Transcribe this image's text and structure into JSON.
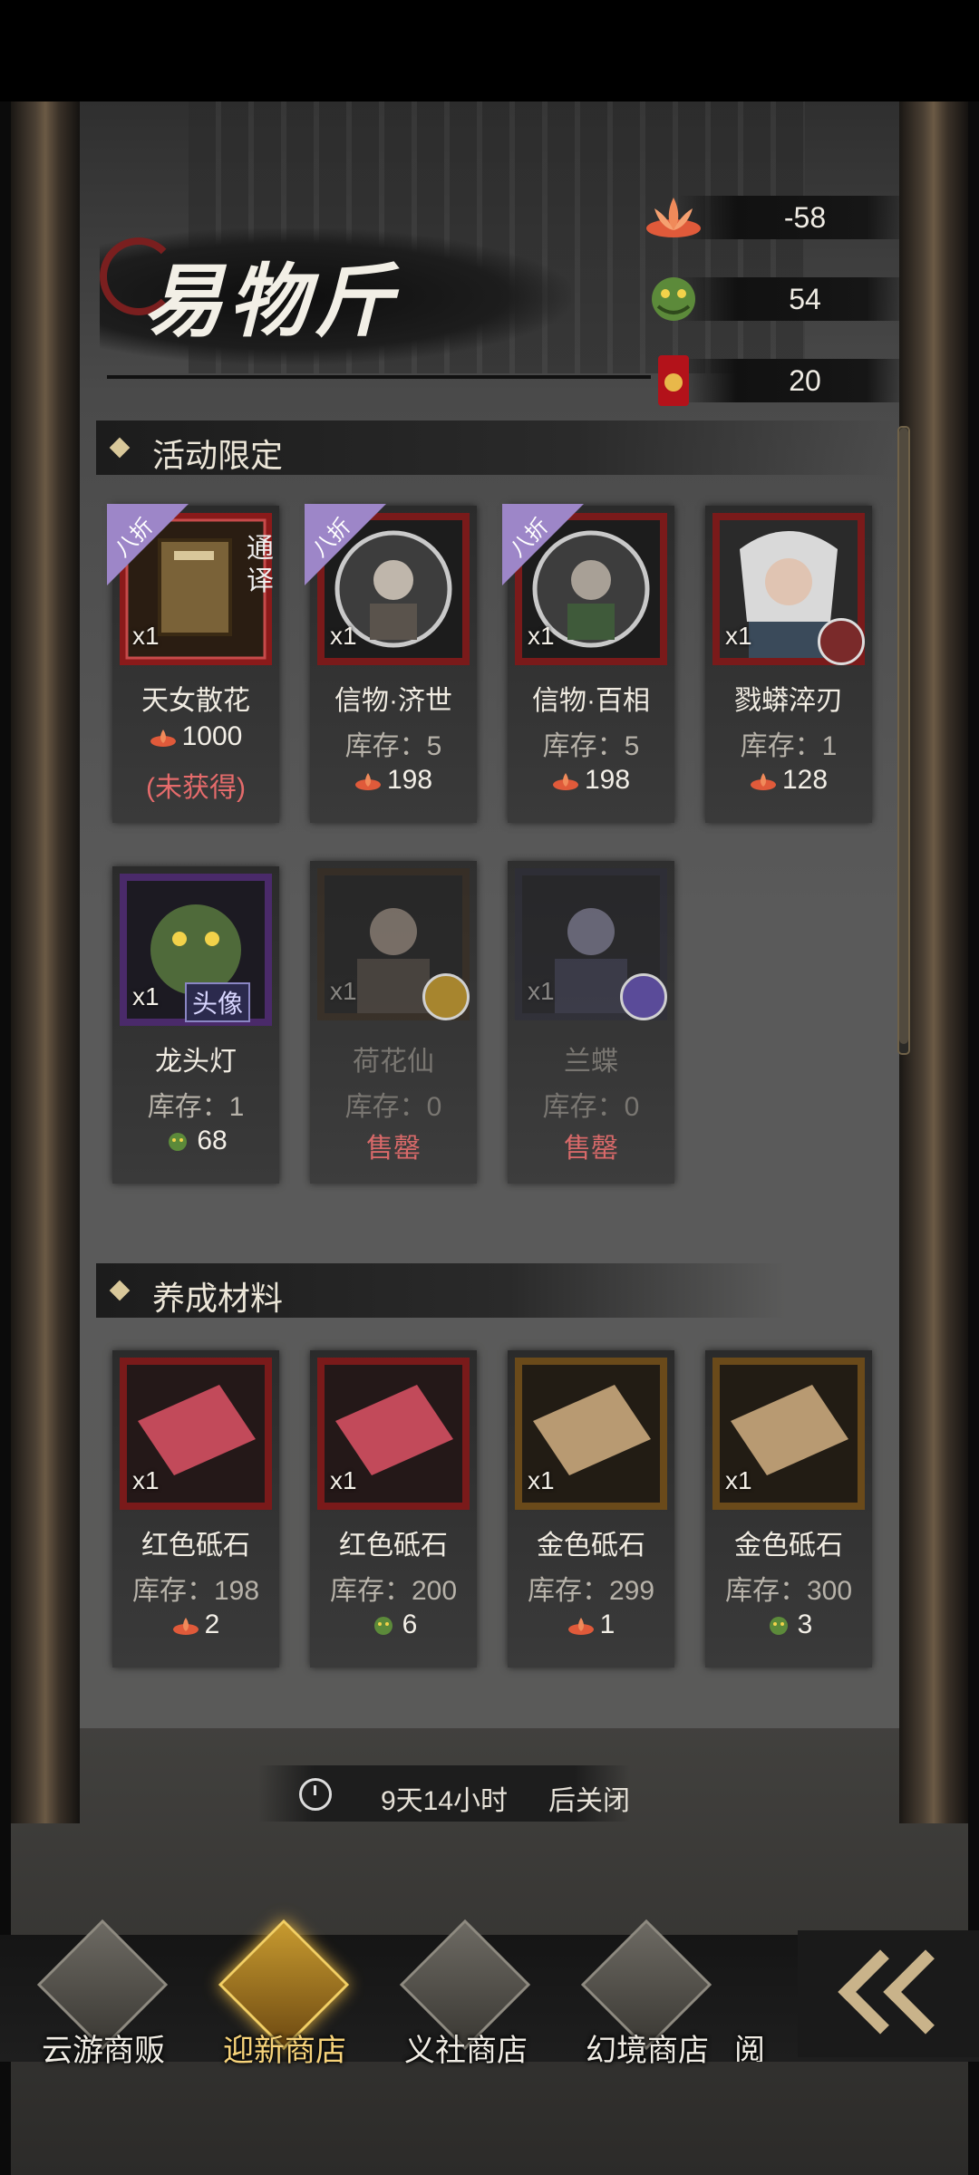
{
  "header": {
    "title": "易物斤",
    "currencies": [
      {
        "icon": "lotus-icon",
        "value": "-58"
      },
      {
        "icon": "dragon-icon",
        "value": "54"
      },
      {
        "icon": "fortune-envelope-icon",
        "value": "20"
      }
    ]
  },
  "sections": [
    {
      "title": "活动限定",
      "items": [
        {
          "name": "天女散花",
          "qty": "x1",
          "discount": "八折",
          "side_tag": "通译",
          "price": "1000",
          "price_icon": "lotus-icon",
          "status": "(未获得)"
        },
        {
          "name": "信物·济世",
          "qty": "x1",
          "discount": "八折",
          "stock": "库存：5",
          "price": "198",
          "price_icon": "lotus-icon"
        },
        {
          "name": "信物·百相",
          "qty": "x1",
          "discount": "八折",
          "stock": "库存：5",
          "price": "198",
          "price_icon": "lotus-icon"
        },
        {
          "name": "戮蟒淬刃",
          "qty": "x1",
          "stock": "库存：1",
          "price": "128",
          "price_icon": "lotus-icon"
        },
        {
          "name": "龙头灯",
          "qty": "x1",
          "tag": "头像",
          "stock": "库存：1",
          "price": "68",
          "price_icon": "dragon-icon"
        },
        {
          "name": "荷花仙",
          "qty": "x1",
          "stock": "库存：0",
          "status": "售罄"
        },
        {
          "name": "兰蝶",
          "qty": "x1",
          "stock": "库存：0",
          "status": "售罄"
        }
      ]
    },
    {
      "title": "养成材料",
      "items": [
        {
          "name": "红色砥石",
          "qty": "x1",
          "stock": "库存：198",
          "price": "2",
          "price_icon": "lotus-icon"
        },
        {
          "name": "红色砥石",
          "qty": "x1",
          "stock": "库存：200",
          "price": "6",
          "price_icon": "dragon-icon"
        },
        {
          "name": "金色砥石",
          "qty": "x1",
          "stock": "库存：299",
          "price": "1",
          "price_icon": "lotus-icon"
        },
        {
          "name": "金色砥石",
          "qty": "x1",
          "stock": "库存：300",
          "price": "3",
          "price_icon": "dragon-icon"
        }
      ]
    }
  ],
  "timer": {
    "remaining": "9天14小时",
    "suffix": "后关闭"
  },
  "tabs": [
    {
      "label": "云游商贩",
      "active": false
    },
    {
      "label": "迎新商店",
      "active": true
    },
    {
      "label": "义社商店",
      "active": false
    },
    {
      "label": "幻境商店",
      "active": false
    },
    {
      "label": "阅",
      "active": false
    }
  ],
  "colors": {
    "accent_gold": "#f7d37a",
    "sold_out_red": "#e56b6b",
    "discount_purple": "#9d86c8"
  }
}
